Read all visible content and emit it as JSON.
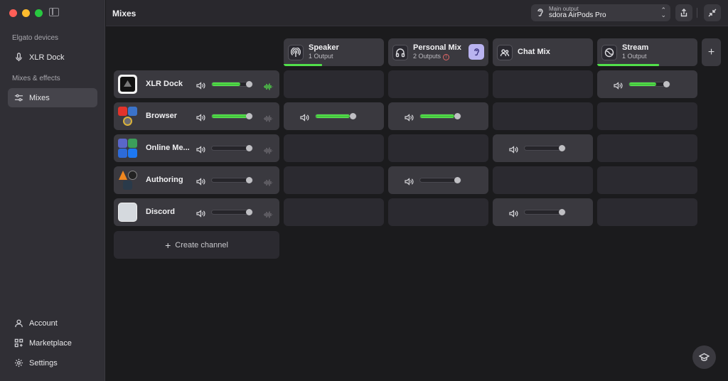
{
  "window": {
    "title": "Mixes"
  },
  "sidebar": {
    "section_devices": "Elgato devices",
    "device": "XLR Dock",
    "section_mixes": "Mixes & effects",
    "mixes": "Mixes",
    "account": "Account",
    "marketplace": "Marketplace",
    "settings": "Settings"
  },
  "topbar": {
    "output_label": "Main output",
    "output_value": "sdora AirPods Pro"
  },
  "mixes": [
    {
      "name": "Speaker",
      "sub": "1 Output",
      "icon": "podcast-icon",
      "level": 0.38
    },
    {
      "name": "Personal Mix",
      "sub": "2 Outputs",
      "icon": "headphones-icon",
      "level": 0
    },
    {
      "name": "Chat Mix",
      "sub": "",
      "icon": "users-icon",
      "level": 0
    },
    {
      "name": "Stream",
      "sub": "1 Output",
      "icon": "stream-icon",
      "level": 0.62
    }
  ],
  "channels": [
    {
      "name": "XLR Dock",
      "volume": 0.75
    },
    {
      "name": "Browser",
      "volume": 0.95
    },
    {
      "name": "Online Me...",
      "volume": 0
    },
    {
      "name": "Authoring",
      "volume": 0
    },
    {
      "name": "Discord",
      "volume": 0
    }
  ],
  "create_channel": "Create channel",
  "colors": {
    "accent_green": "#52e04a",
    "ear_badge": "#b9b3f0"
  }
}
